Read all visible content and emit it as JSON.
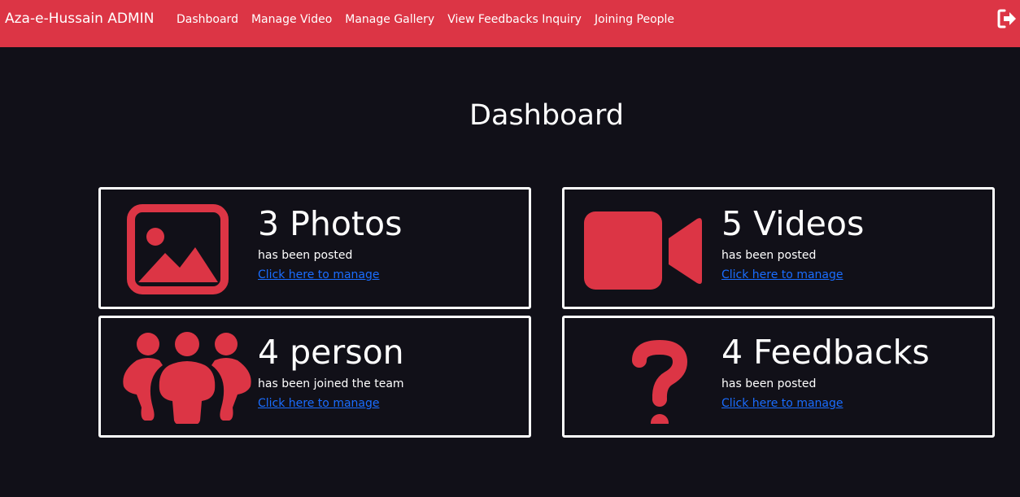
{
  "navbar": {
    "brand": "Aza-e-Hussain ADMIN",
    "links": [
      {
        "label": "Dashboard"
      },
      {
        "label": "Manage Video"
      },
      {
        "label": "Manage Gallery"
      },
      {
        "label": "View Feedbacks Inquiry"
      },
      {
        "label": "Joining People"
      }
    ],
    "logout_icon": "logout-icon"
  },
  "page": {
    "title": "Dashboard"
  },
  "cards": [
    {
      "icon": "image-icon",
      "count": "3 Photos",
      "subtitle": "has been posted",
      "link": "Click here to manage"
    },
    {
      "icon": "video-camera-icon",
      "count": "5 Videos",
      "subtitle": "has been posted",
      "link": "Click here to manage"
    },
    {
      "icon": "users-icon",
      "count": "4 person",
      "subtitle": "has been joined the team",
      "link": "Click here to manage"
    },
    {
      "icon": "question-icon",
      "count": "4 Feedbacks",
      "subtitle": "has been posted",
      "link": "Click here to manage"
    }
  ],
  "colors": {
    "accent": "#dc3545",
    "background": "#111018",
    "link": "#1a6dff"
  }
}
